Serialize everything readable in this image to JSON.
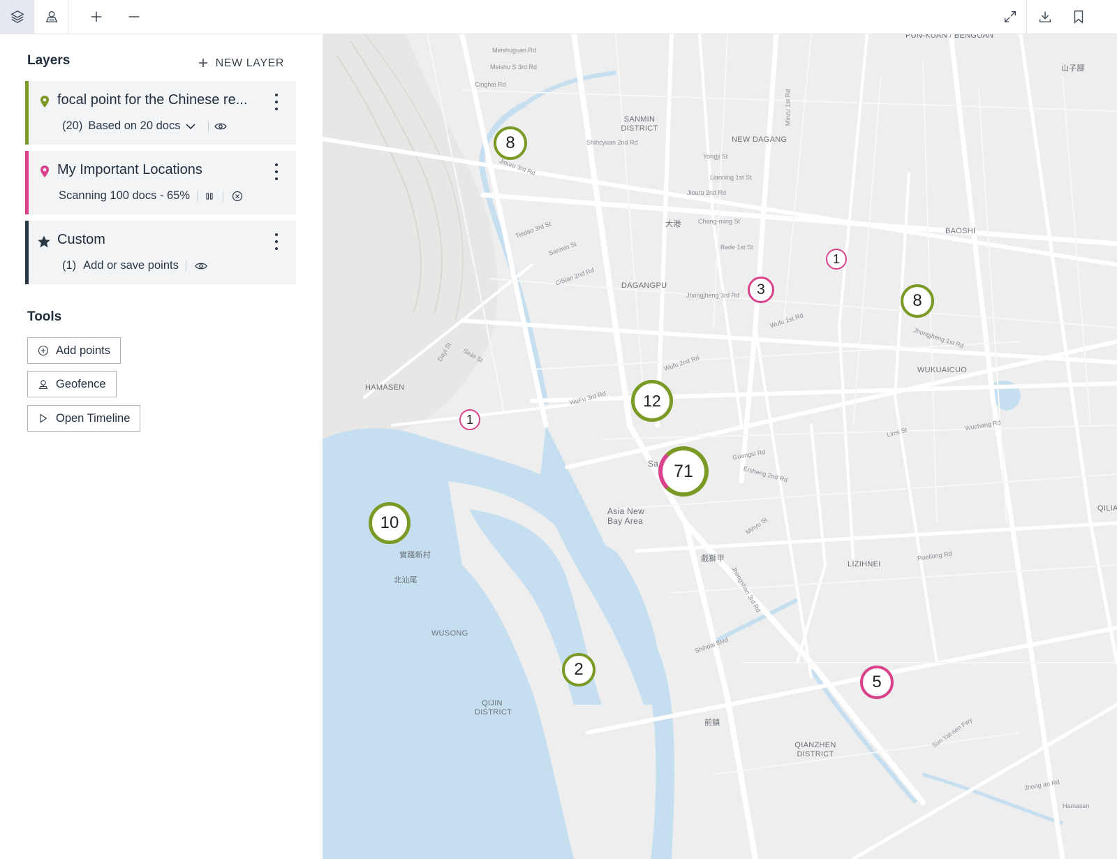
{
  "toolbar": {
    "buttons": [
      {
        "name": "layers-icon",
        "active": true
      },
      {
        "name": "map-style-icon",
        "active": false
      },
      {
        "name": "zoom-in-icon",
        "active": false
      },
      {
        "name": "zoom-out-icon",
        "active": false
      },
      {
        "name": "fullscreen-icon",
        "active": false
      },
      {
        "name": "download-icon",
        "active": false
      },
      {
        "name": "bookmark-icon",
        "active": false
      }
    ]
  },
  "layers": {
    "heading": "Layers",
    "new_layer": "NEW LAYER",
    "items": [
      {
        "title": "focal point for the Chinese re...",
        "count": "(20)",
        "detail": "Based on 20 docs",
        "color": "#7b9a25",
        "icon": "map-pin-icon"
      },
      {
        "title": "My Important Locations",
        "detail": "Scanning 100 docs - 65%",
        "progress": 0.65,
        "color": "#d9428a",
        "icon": "map-pin-icon"
      },
      {
        "title": "Custom",
        "count": "(1)",
        "detail": "Add or save points",
        "color": "#2b3947",
        "icon": "star-icon"
      }
    ]
  },
  "tools": {
    "heading": "Tools",
    "buttons": [
      {
        "label": "Add points",
        "icon": "plus-circle-icon"
      },
      {
        "label": "Geofence",
        "icon": "geofence-icon"
      },
      {
        "label": "Open Timeline",
        "icon": "play-icon"
      }
    ]
  },
  "map": {
    "colors": {
      "green": "#7b9a25",
      "pink": "#d9428a",
      "water": "#c6dff0",
      "land": "#eeeeef",
      "road": "#ffffff"
    },
    "clusters": [
      {
        "label": "8",
        "series": "green"
      },
      {
        "label": "1",
        "series": "pink"
      },
      {
        "label": "3",
        "series": "pink"
      },
      {
        "label": "8",
        "series": "green"
      },
      {
        "label": "12",
        "series": "green"
      },
      {
        "label": "1",
        "series": "pink"
      },
      {
        "label": "71",
        "series": "mixed"
      },
      {
        "label": "10",
        "series": "green"
      },
      {
        "label": "2",
        "series": "green"
      },
      {
        "label": "5",
        "series": "pink"
      }
    ],
    "place_labels": [
      "PUN-KUAN / BENGUAN",
      "山子腳",
      "SANMIN DISTRICT",
      "NEW DAGANG",
      "大港",
      "BAOSHI",
      "DAGANGPU",
      "WUKUAICUO",
      "HAMASEN",
      "Asia New Bay Area",
      "LIZIHNEI",
      "實踐新村",
      "北汕尾",
      "WUSONG",
      "QIJIN DISTRICT",
      "前鎮",
      "QIANZHEN DISTRICT",
      "戲獅甲",
      "QILIA",
      "Sa"
    ],
    "street_labels": [
      "Meishuguan Rd",
      "Meishu S 3rd Rd",
      "Cinghai Rd",
      "Shihcyuan 2nd Rd",
      "Jiouru 3rd Rd",
      "Jiouru 2nd Rd",
      "Chang-ming St",
      "Jhongjheng 3rd Rd",
      "Jhongjheng 1st Rd",
      "Wufu 1st Rd",
      "Wufu 2nd Rd",
      "WuFu 3rd Rd",
      "CiSian 2nd Rd",
      "Jhongshan 3rd Rd",
      "Shihdai Blvd",
      "Sun Yat-sen Fwy",
      "Jhong an Rd",
      "Ruellong Rd",
      "Yongji St",
      "Liaoning 1st St",
      "Bade 1st St",
      "Tiedao 3rd St",
      "Sanmin St",
      "Minzu 1st Rd",
      "Wuchang Rd",
      "Linsi St",
      "Guangsi Rd",
      "Ersheng 2nd Rd",
      "Minyu St",
      "Sinle St",
      "Dayi St",
      "Hamasen"
    ]
  }
}
